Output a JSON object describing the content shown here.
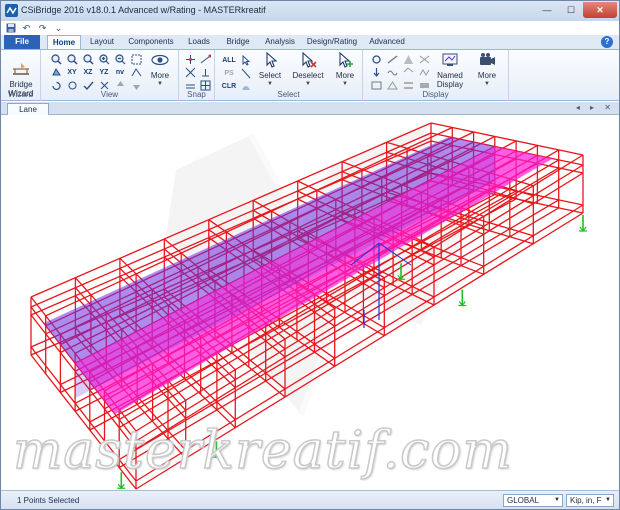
{
  "window": {
    "title": "CSiBridge 2016 v18.0.1 Advanced w/Rating  - MASTERkreatif",
    "min_glyph": "—",
    "max_glyph": "☐",
    "close_glyph": "✕"
  },
  "quick_access": {
    "save_glyph": "💾",
    "undo_glyph": "↶",
    "redo_glyph": "↷",
    "customize_glyph": "⌄"
  },
  "tabs": {
    "file": "File",
    "items": [
      "Home",
      "Layout",
      "Components",
      "Loads",
      "Bridge",
      "Analysis",
      "Design/Rating",
      "Advanced"
    ],
    "active": "Home",
    "help": "?"
  },
  "ribbon": {
    "wizard": {
      "button": "Bridge\nWizard",
      "group": "Wizard"
    },
    "view": {
      "labels": [
        "XY",
        "XZ",
        "YZ",
        "nv"
      ],
      "more": "More",
      "group": "View"
    },
    "snap": {
      "group": "Snap"
    },
    "select": {
      "small": [
        "ALL",
        "PS",
        "CLR"
      ],
      "select_btn": "Select",
      "deselect_btn": "Deselect",
      "more": "More",
      "group": "Select"
    },
    "display": {
      "named_display": "Named\nDisplay",
      "more": "More",
      "group": "Display"
    }
  },
  "document": {
    "tab": "Lane",
    "controls": "◂ ▸ ✕"
  },
  "viewport": {
    "watermark": "masterkreatif.com",
    "colors": {
      "frame": "#e8161c",
      "lane_1": "#6a2ee0",
      "lane_2": "#ff1ad9",
      "support": "#1fc21f",
      "axis": "#1a35d8"
    }
  },
  "status": {
    "text": "1 Points Selected",
    "coord_system": "GLOBAL",
    "units": "Kip, in, F"
  }
}
